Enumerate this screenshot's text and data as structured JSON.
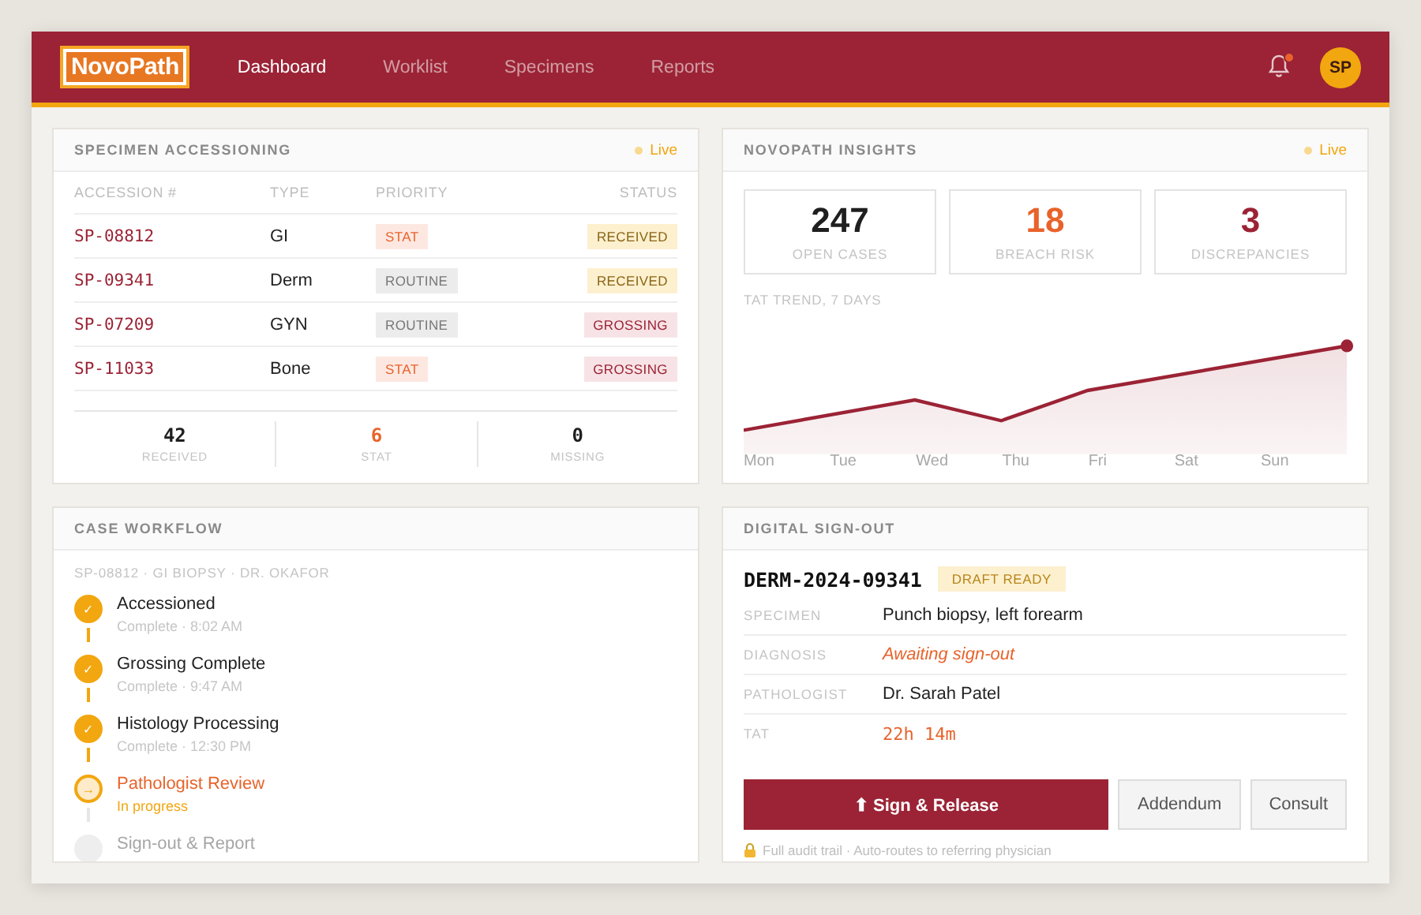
{
  "nav": {
    "logo": "NovoPath",
    "links": [
      {
        "label": "Dashboard",
        "selected": true
      },
      {
        "label": "Worklist",
        "selected": false
      },
      {
        "label": "Specimens",
        "selected": false
      },
      {
        "label": "Reports",
        "selected": false
      }
    ],
    "notifications_unread": true,
    "avatar": "SP"
  },
  "accessioning": {
    "title": "SPECIMEN ACCESSIONING",
    "live": "Live",
    "columns": [
      "ACCESSION #",
      "TYPE",
      "PRIORITY",
      "STATUS"
    ],
    "rows": [
      {
        "accession": "SP-08812",
        "type": "GI",
        "priority": "STAT",
        "status": "RECEIVED"
      },
      {
        "accession": "SP-09341",
        "type": "Derm",
        "priority": "ROUTINE",
        "status": "RECEIVED"
      },
      {
        "accession": "SP-07209",
        "type": "GYN",
        "priority": "ROUTINE",
        "status": "GROSSING"
      },
      {
        "accession": "SP-11033",
        "type": "Bone",
        "priority": "STAT",
        "status": "GROSSING"
      }
    ],
    "stats": [
      {
        "value": "42",
        "label": "RECEIVED",
        "color": "#1f1f1f"
      },
      {
        "value": "6",
        "label": "STAT",
        "color": "#e8632b"
      },
      {
        "value": "0",
        "label": "MISSING",
        "color": "#1f1f1f"
      }
    ]
  },
  "insights": {
    "title": "NOVOPATH INSIGHTS",
    "live": "Live",
    "kpis": [
      {
        "value": "247",
        "label": "OPEN CASES",
        "color": "#1f1f1f"
      },
      {
        "value": "18",
        "label": "BREACH RISK",
        "color": "#e8632b"
      },
      {
        "value": "3",
        "label": "DISCREPANCIES",
        "color": "#9b2335"
      }
    ],
    "trend_title": "TAT TREND, 7 DAYS",
    "days": [
      "Mon",
      "Tue",
      "Wed",
      "Thu",
      "Fri",
      "Sat",
      "Sun"
    ]
  },
  "workflow": {
    "title": "CASE WORKFLOW",
    "case": "SP-08812 · GI BIOPSY · DR. OKAFOR",
    "steps": [
      {
        "kind": "done",
        "mark": "✓",
        "label": "Accessioned",
        "detail": "Complete · 8:02 AM"
      },
      {
        "kind": "done",
        "mark": "✓",
        "label": "Grossing Complete",
        "detail": "Complete · 9:47 AM"
      },
      {
        "kind": "done",
        "mark": "✓",
        "label": "Histology Processing",
        "detail": "Complete · 12:30 PM"
      },
      {
        "kind": "active",
        "mark": "→",
        "label": "Pathologist Review",
        "detail": "In progress"
      },
      {
        "kind": "pending",
        "label": "Sign-out & Report"
      }
    ]
  },
  "signout": {
    "title": "DIGITAL SIGN-OUT",
    "case": "DERM-2024-09341",
    "badge": "DRAFT READY",
    "fields": [
      {
        "kind": "text",
        "label": "SPECIMEN",
        "value": "Punch biopsy, left forearm"
      },
      {
        "kind": "pending",
        "label": "DIAGNOSIS",
        "value": "Awaiting sign-out"
      },
      {
        "kind": "text",
        "label": "PATHOLOGIST",
        "value": "Dr. Sarah Patel"
      },
      {
        "kind": "timer",
        "label": "TAT",
        "value": "22h 14m"
      }
    ],
    "primary": "⬆ Sign & Release",
    "secondary": [
      "Addendum",
      "Consult"
    ],
    "footnote": "Full audit trail · Auto-routes to referring physician"
  }
}
